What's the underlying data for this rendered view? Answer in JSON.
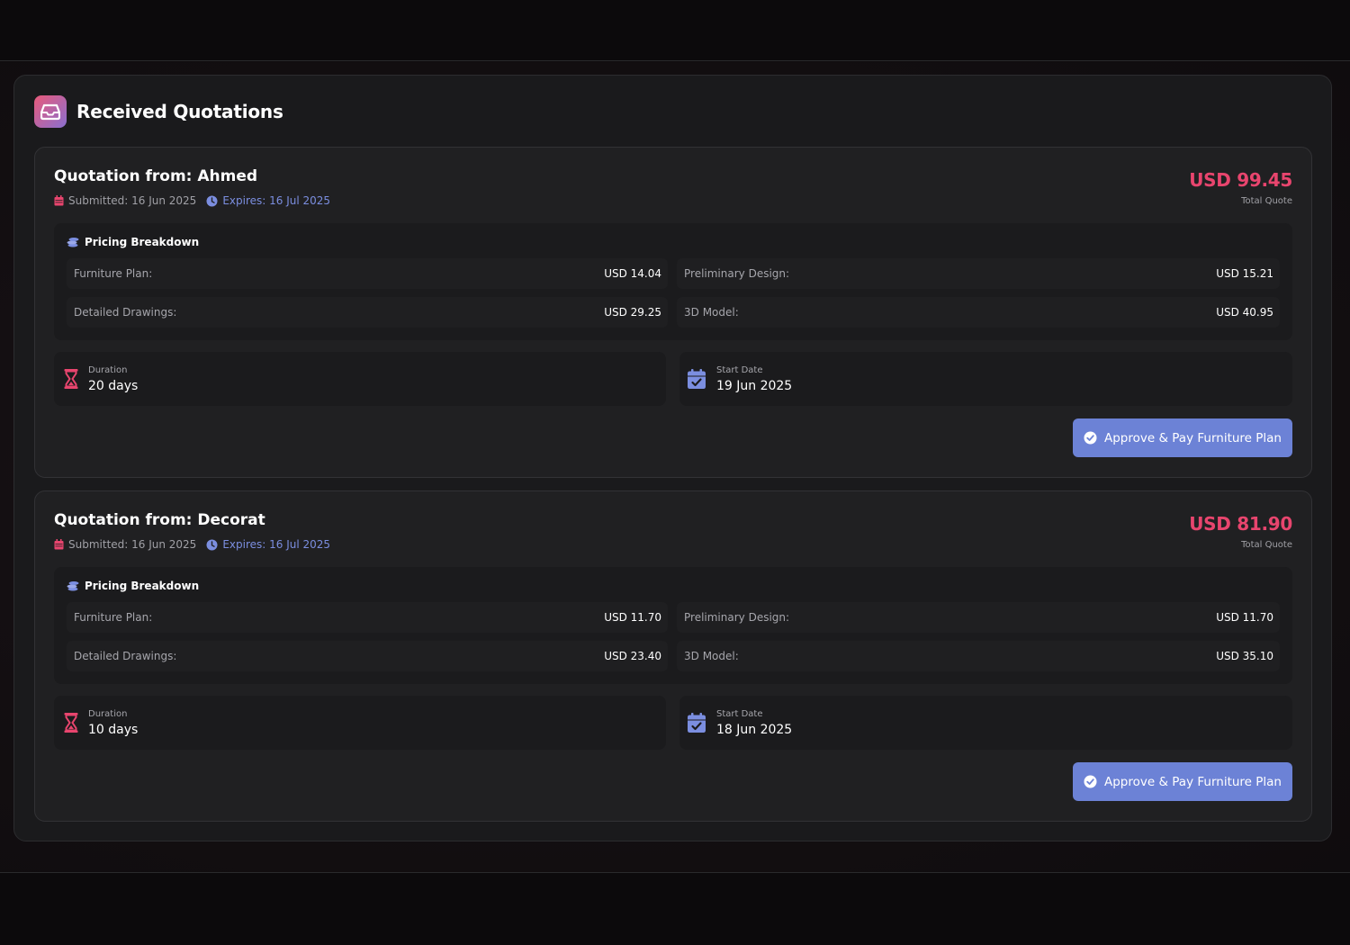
{
  "panel": {
    "title": "Received Quotations"
  },
  "quotations": [
    {
      "title": "Quotation from: Ahmed",
      "submitted": "Submitted: 16 Jun 2025",
      "expires": "Expires: 16 Jul 2025",
      "total": "USD 99.45",
      "total_label": "Total Quote",
      "breakdown_title": "Pricing Breakdown",
      "items": [
        {
          "label": "Furniture Plan:",
          "value": "USD 14.04"
        },
        {
          "label": "Preliminary Design:",
          "value": "USD 15.21"
        },
        {
          "label": "Detailed Drawings:",
          "value": "USD 29.25"
        },
        {
          "label": "3D Model:",
          "value": "USD 40.95"
        }
      ],
      "duration_label": "Duration",
      "duration": "20 days",
      "start_label": "Start Date",
      "start": "19 Jun 2025",
      "approve_label": "Approve & Pay Furniture Plan"
    },
    {
      "title": "Quotation from: Decorat",
      "submitted": "Submitted: 16 Jun 2025",
      "expires": "Expires: 16 Jul 2025",
      "total": "USD 81.90",
      "total_label": "Total Quote",
      "breakdown_title": "Pricing Breakdown",
      "items": [
        {
          "label": "Furniture Plan:",
          "value": "USD 11.70"
        },
        {
          "label": "Preliminary Design:",
          "value": "USD 11.70"
        },
        {
          "label": "Detailed Drawings:",
          "value": "USD 23.40"
        },
        {
          "label": "3D Model:",
          "value": "USD 35.10"
        }
      ],
      "duration_label": "Duration",
      "duration": "10 days",
      "start_label": "Start Date",
      "start": "18 Jun 2025",
      "approve_label": "Approve & Pay Furniture Plan"
    }
  ],
  "icons": {
    "header": "inbox-icon",
    "submitted": "calendar-icon",
    "expires": "clock-icon",
    "breakdown": "coins-icon",
    "duration": "hourglass-icon",
    "start": "calendar-check-icon",
    "approve": "check-circle-icon"
  },
  "colors": {
    "accent_total": "#e8456e",
    "accent_expires": "#7b8ee0",
    "approve_button": "#6c82d6",
    "hourglass": "#e8456e",
    "calendar_check": "#7b8ee0"
  }
}
